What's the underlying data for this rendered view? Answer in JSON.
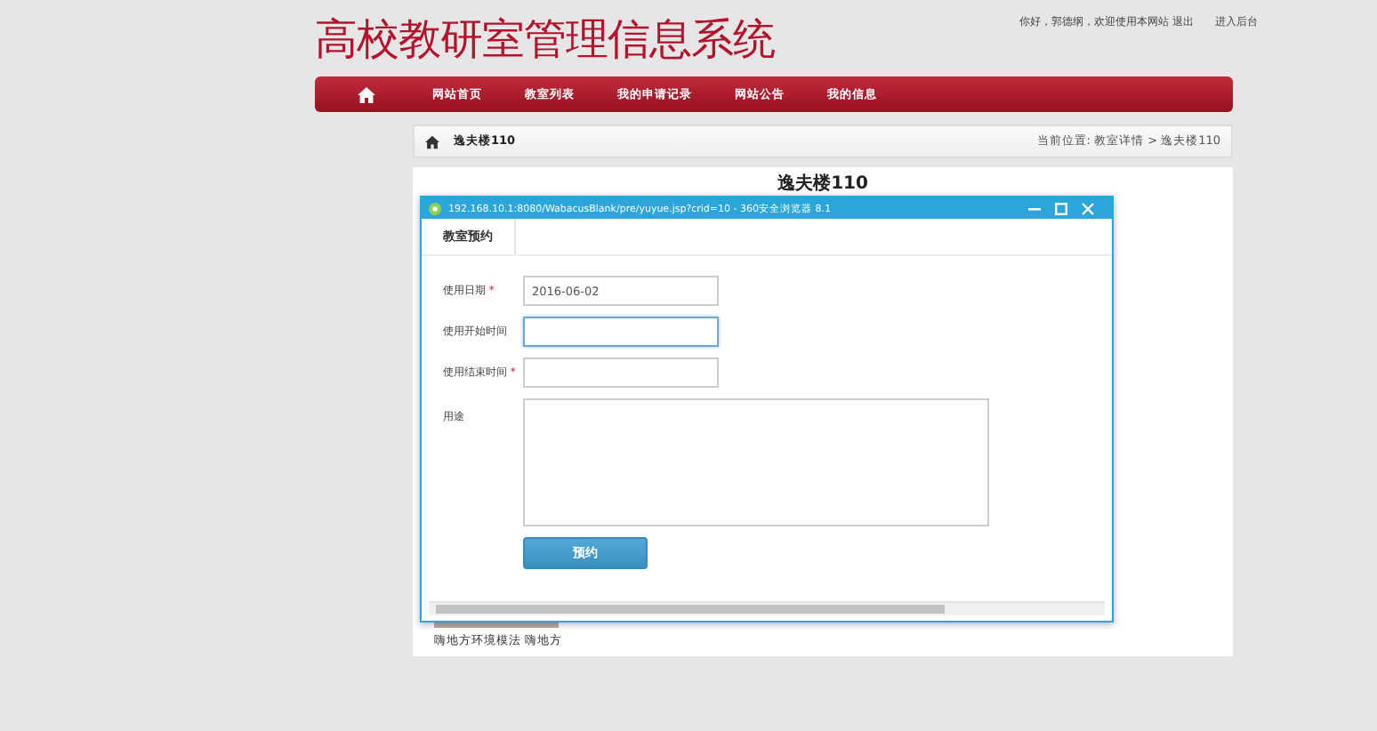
{
  "site": {
    "title": "高校教研室管理信息系统",
    "greeting": "你好，郭德纲，欢迎使用本网站 退出",
    "admin_link": "进入后台"
  },
  "nav": {
    "items": [
      {
        "label": "网站首页"
      },
      {
        "label": "教室列表"
      },
      {
        "label": "我的申请记录"
      },
      {
        "label": "网站公告"
      },
      {
        "label": "我的信息"
      }
    ]
  },
  "breadcrumb": {
    "current": "逸夫楼110",
    "location": "当前位置: 教室详情 > 逸夫楼110"
  },
  "content": {
    "title": "逸夫楼110",
    "footer_text": "嗨地方环境模法 嗨地方"
  },
  "dialog": {
    "title": "192.168.10.1:8080/WabacusBlank/pre/yuyue.jsp?crid=10 - 360安全浏览器 8.1",
    "tabs": [
      {
        "label": "教室预约",
        "selected": true
      }
    ],
    "fields": [
      {
        "kind": "input",
        "label": "使用日期",
        "required_mark": "*",
        "value": "2016-06-02",
        "focused": false
      },
      {
        "kind": "input",
        "label": "使用开始时间",
        "focused": true
      },
      {
        "kind": "input",
        "label": "使用结束时间",
        "required_mark": "*",
        "focused": false
      },
      {
        "kind": "textarea",
        "label": "用途",
        "focused": false
      }
    ],
    "submit": "预约"
  }
}
